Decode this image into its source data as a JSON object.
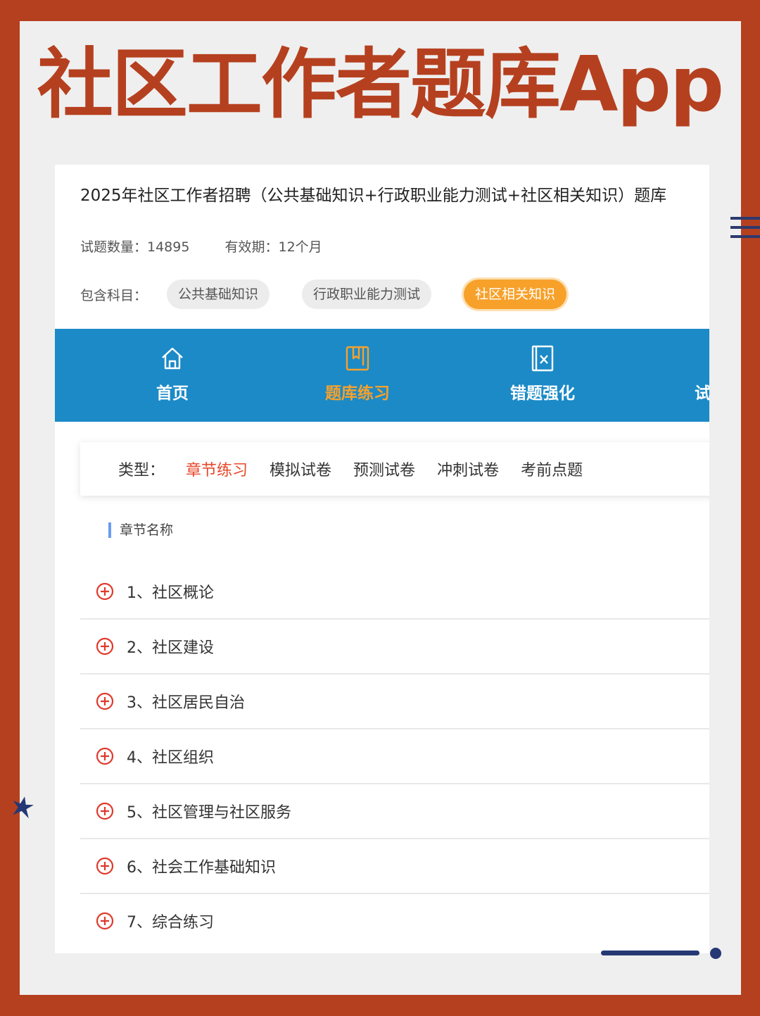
{
  "banner": {
    "title": "社区工作者题库App"
  },
  "exam": {
    "title": "2025年社区工作者招聘（公共基础知识+行政职业能力测试+社区相关知识）题库",
    "count_label": "试题数量：14895",
    "validity_label": "有效期：12个月",
    "subjects_label": "包含科目：",
    "subjects": [
      "公共基础知识",
      "行政职业能力测试",
      "社区相关知识"
    ]
  },
  "nav": {
    "items": [
      {
        "label": "首页",
        "icon": "home-icon"
      },
      {
        "label": "题库练习",
        "icon": "book-icon"
      },
      {
        "label": "错题强化",
        "icon": "wrong-question-icon"
      },
      {
        "label": "试"
      }
    ],
    "active": "题库练习"
  },
  "types": {
    "label": "类型：",
    "items": [
      "章节练习",
      "模拟试卷",
      "预测试卷",
      "冲刺试卷",
      "考前点题"
    ],
    "active": "章节练习"
  },
  "chapters": {
    "heading": "章节名称",
    "items": [
      "1、社区概论",
      "2、社区建设",
      "3、社区居民自治",
      "4、社区组织",
      "5、社区管理与社区服务",
      "6、社会工作基础知识",
      "7、综合练习"
    ]
  },
  "colors": {
    "frame": "#b5401f",
    "nav_bg": "#1b8ac7",
    "accent_orange": "#f7a12b",
    "active_red": "#e8472a"
  }
}
